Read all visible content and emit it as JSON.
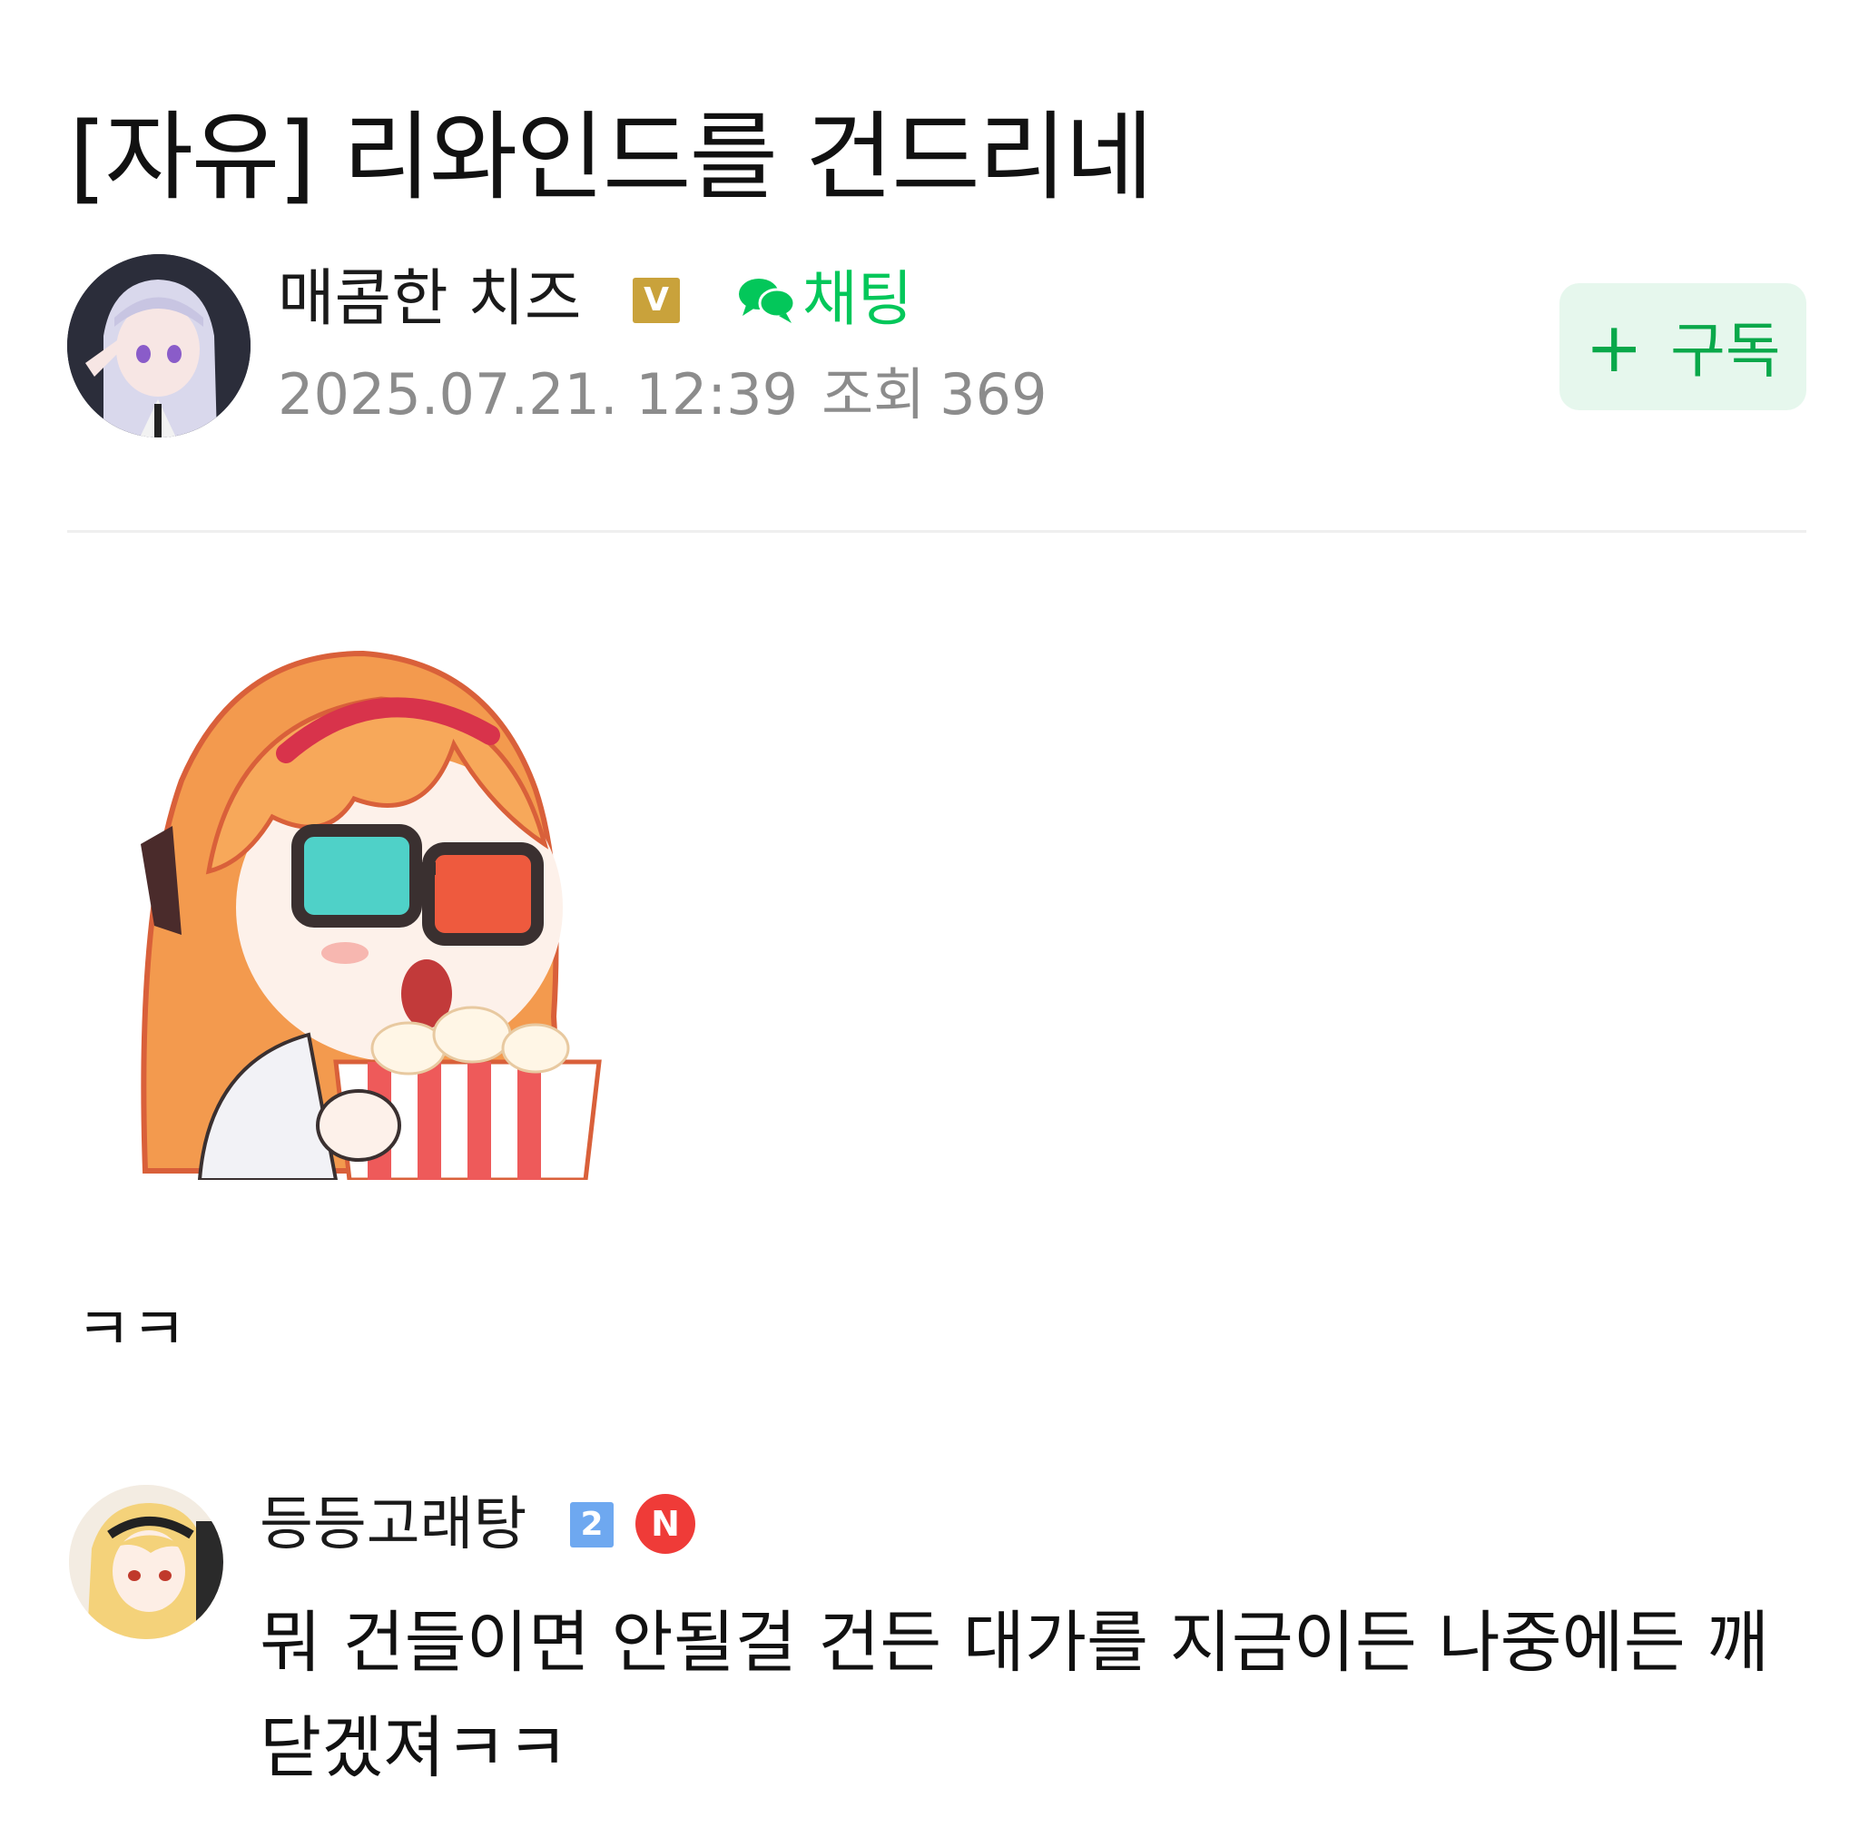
{
  "post": {
    "title": "[자유] 리와인드를 건드리네",
    "author": {
      "name": "매콤한 치즈",
      "badge": "V",
      "chat_label": "채팅",
      "avatar_icon": "user-avatar-icon"
    },
    "date": "2025.07.21. 12:39",
    "views_label": "조회",
    "views_count": "369",
    "subscribe": {
      "plus": "+",
      "label": "구독"
    },
    "sticker_icon": "popcorn-girl-sticker",
    "body": "ㅋㅋ"
  },
  "comment": {
    "author": "등등고래탕",
    "level_badge": "2",
    "new_badge": "N",
    "text": "뭐 건들이면 안될걸 건든 대가를 지금이든 나중에든 깨닫겠져ㅋㅋ",
    "avatar_icon": "user-avatar-icon"
  },
  "colors": {
    "accent_green": "#03c75a",
    "subscribe_bg": "#e6f7ed",
    "badge_gold": "#c9a23b",
    "level_blue": "#6ea8f0",
    "new_red": "#ef3b38",
    "meta_gray": "#8c8c8c"
  }
}
